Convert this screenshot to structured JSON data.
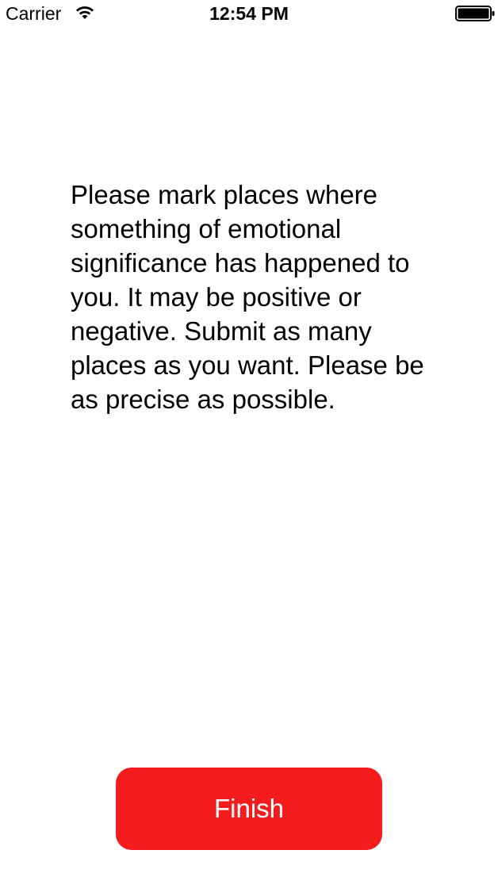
{
  "status_bar": {
    "carrier": "Carrier",
    "time": "12:54 PM",
    "wifi_icon": "wifi-icon",
    "battery_icon": "battery-full-icon"
  },
  "main": {
    "instructions": "Please mark places where something of emotional significance has happened to you. It may be positive or negative. Submit as many places as you want. Please be as precise as possible."
  },
  "actions": {
    "finish_label": "Finish"
  },
  "colors": {
    "accent": "#f41c1c",
    "text": "#000000",
    "background": "#ffffff"
  }
}
